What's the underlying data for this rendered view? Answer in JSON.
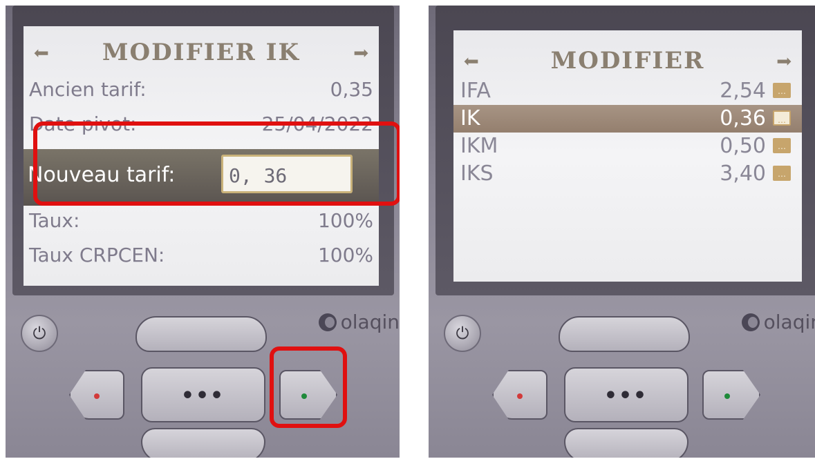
{
  "left_screen": {
    "title": "MODIFIER IK",
    "rows": [
      {
        "label": "Ancien tarif:",
        "value": "0,35"
      },
      {
        "label": "Date pivot:",
        "value": "25/04/2022"
      },
      {
        "label": "Taux:",
        "value": "100%"
      },
      {
        "label": "Taux CRPCEN:",
        "value": "100%"
      }
    ],
    "highlight": {
      "label": "Nouveau tarif:",
      "input_value": "0, 36"
    }
  },
  "right_screen": {
    "title": "MODIFIER",
    "items": [
      {
        "label": "IFA",
        "value": "2,54",
        "selected": false
      },
      {
        "label": "IK",
        "value": "0,36",
        "selected": true
      },
      {
        "label": "IKM",
        "value": "0,50",
        "selected": false
      },
      {
        "label": "IKS",
        "value": "3,40",
        "selected": false
      }
    ]
  },
  "device": {
    "brand": "olaqin",
    "center_button_label": "•••",
    "led_colors": {
      "left": "#d23a3a",
      "right": "#1f8a3a"
    },
    "annotation_color": "#e01010"
  }
}
